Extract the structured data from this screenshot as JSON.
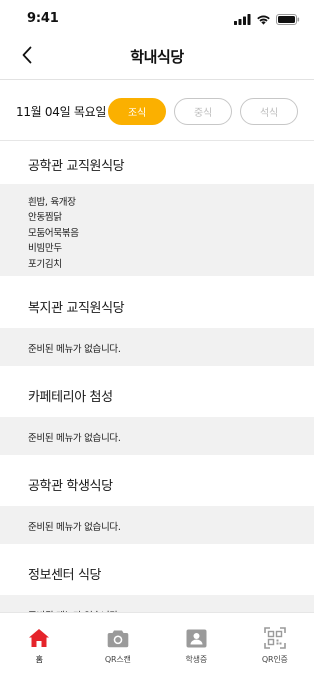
{
  "status_bar": {
    "time": "9:41",
    "icons": [
      "signal-icon",
      "wifi-icon",
      "battery-icon"
    ]
  },
  "header": {
    "back_icon": "chevron-left-icon",
    "title": "학내식당"
  },
  "date_bar": {
    "date": "11월 04일 목요일",
    "meals": [
      {
        "label": "조식",
        "selected": true
      },
      {
        "label": "중식",
        "selected": false
      },
      {
        "label": "석식",
        "selected": false
      }
    ]
  },
  "cafeterias": [
    {
      "name": "공학관 교직원식당",
      "items": [
        "흰밥, 육개장",
        "안동찜닭",
        "모둠어묵볶음",
        "비빔만두",
        "포기김치"
      ]
    },
    {
      "name": "복지관 교직원식당",
      "empty_text": "준비된 메뉴가 없습니다."
    },
    {
      "name": "카페테리아 첨성",
      "empty_text": "준비된 메뉴가 없습니다."
    },
    {
      "name": "공학관 학생식당",
      "empty_text": "준비된 메뉴가 없습니다."
    },
    {
      "name": "정보센터 식당",
      "empty_text": "준비된 메뉴가 없습니다."
    }
  ],
  "tab_bar": {
    "tabs": [
      {
        "label": "홈",
        "icon": "home-icon",
        "active": true
      },
      {
        "label": "QR스캔",
        "icon": "camera-icon",
        "active": false
      },
      {
        "label": "학생증",
        "icon": "id-card-icon",
        "active": false
      },
      {
        "label": "QR인증",
        "icon": "qr-code-icon",
        "active": false
      }
    ]
  },
  "colors": {
    "accent": "#fbb000",
    "home_active": "#e5242b",
    "tab_inactive": "#9a9a9a",
    "menu_background": "#f1f1f1"
  }
}
